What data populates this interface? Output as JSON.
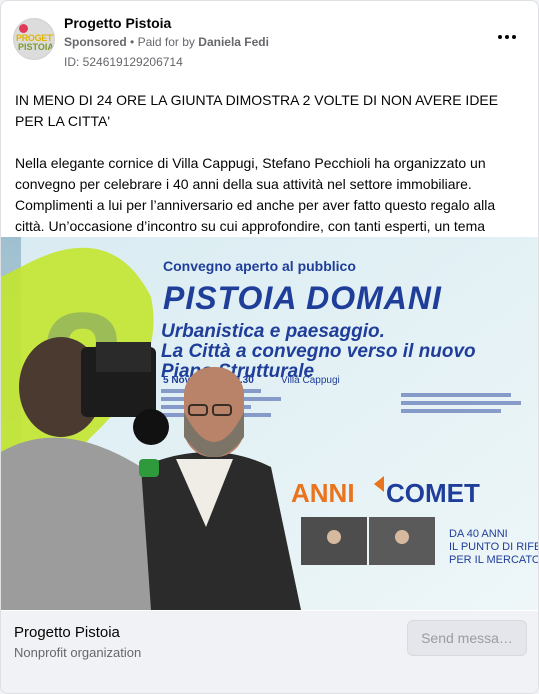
{
  "header": {
    "page_name": "Progetto Pistoia",
    "sponsored_label": "Sponsored",
    "paid_for_label": "Paid for by",
    "payer": "Daniela Fedi",
    "ad_id": "ID: 524619129206714",
    "avatar_logo_text": [
      "PROGETTO",
      "PISTOIA"
    ],
    "more_icon": "ellipsis-icon"
  },
  "post": {
    "paragraph1": "IN MENO DI 24 ORE LA GIUNTA DIMOSTRA 2 VOLTE DI NON AVERE IDEE PER LA CITTA'",
    "paragraph2": "Nella elegante cornice di Villa Cappugi, Stefano Pecchioli ha organizzato un convegno per celebrare i 40 anni della sua attività nel settore immobiliare. Complimenti a lui per l’anniversario ed anche per aver fatto questo regalo alla città. Un’occasione d’incontro su cui approfondire, con tanti esperti, un tema dirimente…"
  },
  "media": {
    "banner_subtitle": "Convegno aperto al pubblico",
    "banner_title": "PISTOIA DOMANI",
    "banner_line1": "Urbanistica e paesaggio.",
    "banner_line2": "La Città a convegno verso il nuovo",
    "banner_line3": "Piano Strutturale",
    "banner_date": "5 Nov",
    "banner_time": "ore 9.30",
    "banner_place": "Villa Cappugi",
    "big_number": "2",
    "sponsor_partial": "ANNI",
    "sponsor_brand": "COMET",
    "anniversary_line1": "DA 40 ANNI",
    "anniversary_line2": "IL PUNTO DI RIFER",
    "anniversary_line3": "PER IL MERCATO I"
  },
  "footer": {
    "page_name": "Progetto Pistoia",
    "category": "Nonprofit organization",
    "send_button": "Send messa…"
  },
  "colors": {
    "brand_blue": "#1f3e9a",
    "banner_green": "#c3e62e",
    "comet_orange": "#e9741d",
    "text_primary": "#050505",
    "text_secondary": "#65676b"
  }
}
